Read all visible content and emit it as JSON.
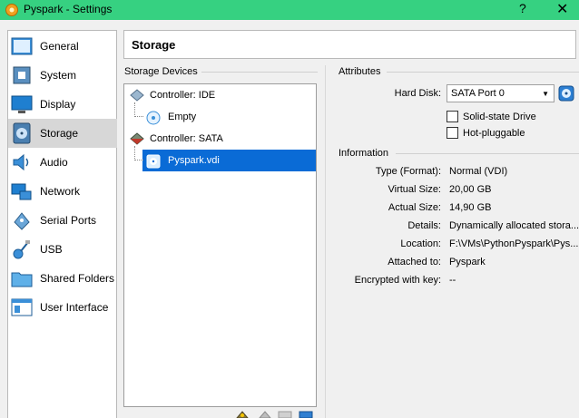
{
  "window": {
    "title": "Pyspark - Settings",
    "help_glyph": "?",
    "close_glyph": "✕",
    "accent": "#36d181"
  },
  "sidebar": {
    "items": [
      {
        "label": "General",
        "icon": "general-icon"
      },
      {
        "label": "System",
        "icon": "system-icon"
      },
      {
        "label": "Display",
        "icon": "display-icon"
      },
      {
        "label": "Storage",
        "icon": "storage-icon",
        "selected": true
      },
      {
        "label": "Audio",
        "icon": "audio-icon"
      },
      {
        "label": "Network",
        "icon": "network-icon"
      },
      {
        "label": "Serial Ports",
        "icon": "serial-ports-icon"
      },
      {
        "label": "USB",
        "icon": "usb-icon"
      },
      {
        "label": "Shared Folders",
        "icon": "shared-folders-icon"
      },
      {
        "label": "User Interface",
        "icon": "user-interface-icon"
      }
    ]
  },
  "header": {
    "title": "Storage"
  },
  "storage_devices": {
    "label": "Storage Devices",
    "tree": [
      {
        "label": "Controller: IDE",
        "type": "controller"
      },
      {
        "label": "Empty",
        "type": "optical"
      },
      {
        "label": "Controller: SATA",
        "type": "controller"
      },
      {
        "label": "Pyspark.vdi",
        "type": "disk",
        "selected": true
      }
    ]
  },
  "attributes": {
    "label": "Attributes",
    "hard_disk_label": "Hard Disk:",
    "hard_disk_value": "SATA Port 0",
    "solid_state_label": "Solid-state Drive",
    "solid_state_checked": false,
    "hot_pluggable_label": "Hot-pluggable",
    "hot_pluggable_checked": false
  },
  "information": {
    "label": "Information",
    "rows": [
      {
        "key": "Type (Format):",
        "value": "Normal (VDI)"
      },
      {
        "key": "Virtual Size:",
        "value": "20,00 GB"
      },
      {
        "key": "Actual Size:",
        "value": "14,90 GB"
      },
      {
        "key": "Details:",
        "value": "Dynamically allocated stora..."
      },
      {
        "key": "Location:",
        "value": "F:\\VMs\\PythonPyspark\\Pys..."
      },
      {
        "key": "Attached to:",
        "value": "Pyspark"
      },
      {
        "key": "Encrypted with key:",
        "value": "--"
      }
    ]
  }
}
